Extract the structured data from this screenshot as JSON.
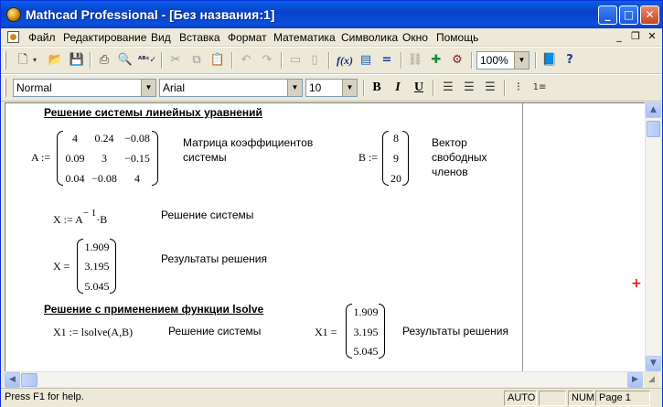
{
  "window": {
    "title": "Mathcad Professional - [Без названия:1]",
    "minimize": "_",
    "maximize": "□",
    "close": "✕"
  },
  "menu": {
    "items": [
      "Файл",
      "Редактирование",
      "Вид",
      "Вставка",
      "Формат",
      "Математика",
      "Символика",
      "Окно",
      "Помощь"
    ],
    "mdi_min": "_",
    "mdi_restore": "❐",
    "mdi_close": "✕"
  },
  "toolbar": {
    "zoom": "100%",
    "formula_btn": "f(x)"
  },
  "format_toolbar": {
    "style": "Normal",
    "font": "Arial",
    "size": "10",
    "bold": "B",
    "italic": "I",
    "underline": "U"
  },
  "doc": {
    "header1": "Решение системы линейных уравнений",
    "a_label": "A :=",
    "a_matrix": [
      [
        "4",
        "0.24",
        "−0.08"
      ],
      [
        "0.09",
        "3",
        "−0.15"
      ],
      [
        "0.04",
        "−0.08",
        "4"
      ]
    ],
    "a_desc": [
      "Матрица коэффициентов",
      "системы"
    ],
    "b_label": "B :=",
    "b_vector": [
      "8",
      "9",
      "20"
    ],
    "b_desc": [
      "Вектор",
      "свободных",
      "членов"
    ],
    "x_def": {
      "lhs": "X := A",
      "exp": "− 1",
      "rhs": "·B"
    },
    "x_def_desc": "Решение системы",
    "x_result_label": "X =",
    "x_vector": [
      "1.909",
      "3.195",
      "5.045"
    ],
    "x_result_desc": "Результаты решения",
    "header2": "Решение с применением функции lsolve",
    "x1_def": "X1 := lsolve(A,B)",
    "x1_def_desc": "Решение системы",
    "x1_result_label": "X1 =",
    "x1_vector": [
      "1.909",
      "3.195",
      "5.045"
    ],
    "x1_result_desc": "Результаты решения",
    "cursor": "+"
  },
  "status": {
    "help": "Press F1 for help.",
    "mode": "AUTO",
    "num": "NUM",
    "page": "Page 1"
  },
  "colors": {
    "titlebar": "#0A4FDB",
    "chrome": "#ECE9D8",
    "cursor": "#E11111"
  }
}
